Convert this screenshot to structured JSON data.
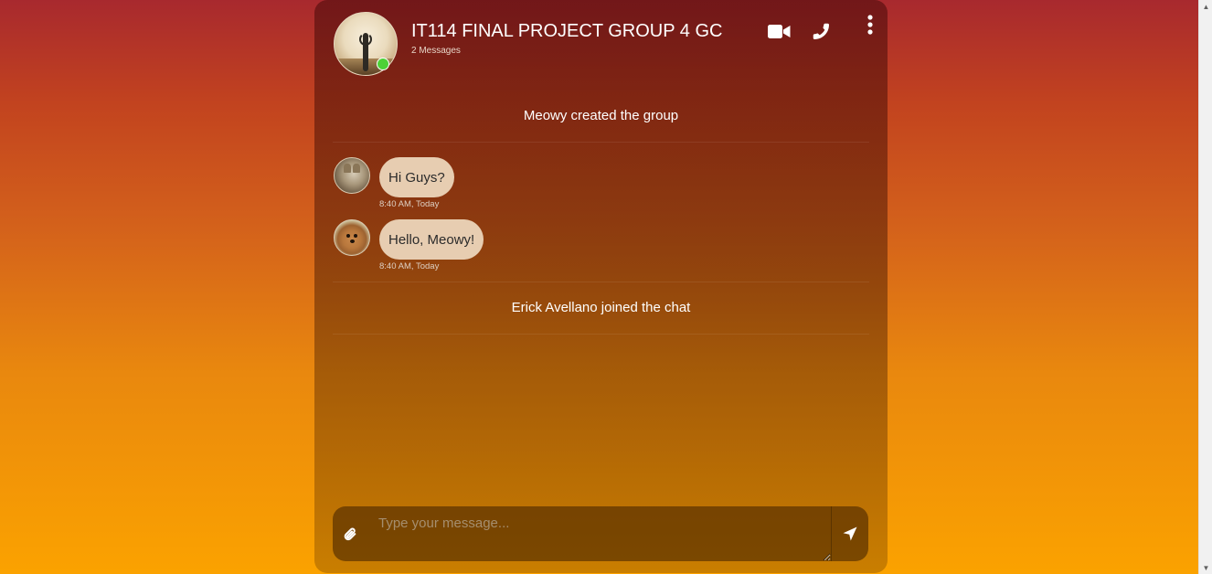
{
  "header": {
    "title": "IT114 FINAL PROJECT GROUP 4 GC",
    "message_count": "2 Messages",
    "icons": [
      "video-camera-icon",
      "phone-icon",
      "more-vertical-icon"
    ],
    "status": "online"
  },
  "chat": {
    "system_messages": [
      "Meowy created the group",
      "Erick Avellano joined the chat"
    ],
    "messages": [
      {
        "text": "Hi Guys?",
        "time": "8:40 AM, Today",
        "avatar": "cat-avatar"
      },
      {
        "text": "Hello, Meowy!",
        "time": "8:40 AM, Today",
        "avatar": "dog-avatar"
      }
    ]
  },
  "composer": {
    "placeholder": "Type your message...",
    "value": "",
    "icons": [
      "paperclip-icon",
      "send-icon"
    ]
  },
  "colors": {
    "bubble": "#e7cdb1",
    "online": "#4cd137",
    "gradient_top": "#a8292e",
    "gradient_bottom": "#fba200"
  }
}
